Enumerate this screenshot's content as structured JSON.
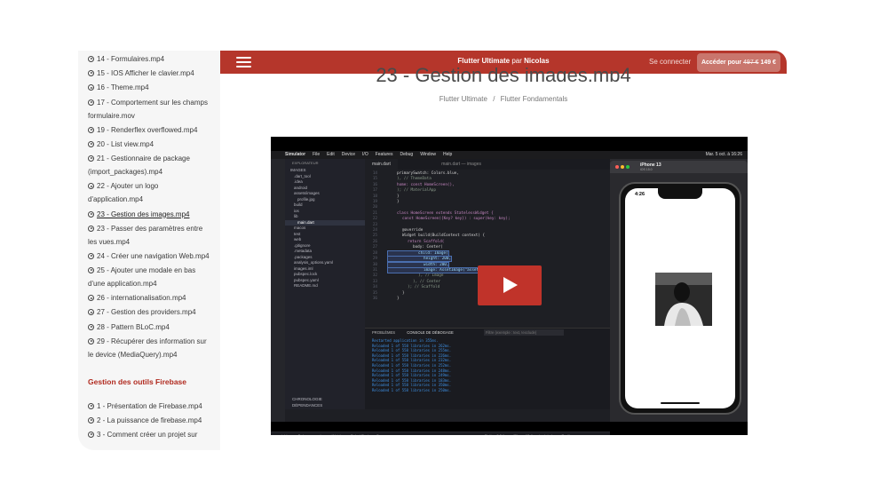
{
  "sidebar": {
    "lessons": [
      {
        "label": "14 - Formulaires.mp4"
      },
      {
        "label": "15 - IOS Afficher le clavier.mp4"
      },
      {
        "label": "16 - Theme.mp4"
      },
      {
        "label": "17 - Comportement sur les champs formulaire.mov"
      },
      {
        "label": "19 - Renderflex overflowed.mp4"
      },
      {
        "label": "20 - List view.mp4"
      },
      {
        "label": "21 - Gestionnaire de package (import_packages).mp4"
      },
      {
        "label": "22 - Ajouter un logo d'application.mp4"
      },
      {
        "label": "23 - Gestion des images.mp4"
      },
      {
        "label": "23 - Passer des paramètres entre les vues.mp4"
      },
      {
        "label": "24 - Créer une navigation Web.mp4"
      },
      {
        "label": "25 - Ajouter une modale en bas d'une application.mp4"
      },
      {
        "label": "26 - internationalisation.mp4"
      },
      {
        "label": "27 - Gestion des providers.mp4"
      },
      {
        "label": "28 - Pattern BLoC.mp4"
      },
      {
        "label": "29 - Récupérer des information sur le device (MediaQuery).mp4"
      }
    ],
    "section2_title": "Gestion des outils Firebase",
    "section2_lessons": [
      {
        "label": "1 - Présentation de Firebase.mp4"
      },
      {
        "label": "2 - La puissance de firebase.mp4"
      },
      {
        "label": "3 - Comment créer un projet sur"
      }
    ]
  },
  "header": {
    "course_name": "Flutter Ultimate",
    "by": "par",
    "author": "Nicolas",
    "login": "Se connecter",
    "access_label": "Accéder pour",
    "old_price": "497 €",
    "new_price": "149 €"
  },
  "page": {
    "title": "23 - Gestion des images.mp4",
    "breadcrumb": [
      "Flutter Ultimate",
      "Flutter Fondamentals"
    ],
    "breadcrumb_sep": "/"
  },
  "video": {
    "mac_menu": [
      "Simulator",
      "File",
      "Edit",
      "Device",
      "I/O",
      "Features",
      "Debug",
      "Window",
      "Help"
    ],
    "mac_clock": "Mar. 5 oct. à 16:26",
    "window_title": "main.dart — images",
    "explorer_title": "EXPLORATEUR",
    "explorer_items": [
      "IMAGES",
      ".dart_tool",
      ".idea",
      "android",
      "assets/images",
      "profile.jpg",
      "build",
      "ios",
      "lib",
      "main.dart",
      "macos",
      "test",
      "web",
      ".gitignore",
      ".metadata",
      ".packages",
      "analysis_options.yaml",
      "images.iml",
      "pubspec.lock",
      "pubspec.yaml",
      "README.md"
    ],
    "tab": "main.dart",
    "code_lines": [
      {
        "n": "14",
        "t": "primarySwatch: Colors.blue,"
      },
      {
        "n": "15",
        "t": "), // ThemeData"
      },
      {
        "n": "16",
        "t": "home: const HomeScreen(),"
      },
      {
        "n": "17",
        "t": "); // MaterialApp"
      },
      {
        "n": "18",
        "t": "}"
      },
      {
        "n": "19",
        "t": "}"
      },
      {
        "n": "20",
        "t": ""
      },
      {
        "n": "21",
        "t": "class HomeScreen extends StatelessWidget {"
      },
      {
        "n": "22",
        "t": "const HomeScreen({Key? key}) : super(key: key);"
      },
      {
        "n": "23",
        "t": ""
      },
      {
        "n": "24",
        "t": "@override"
      },
      {
        "n": "25",
        "t": "Widget build(BuildContext context) {"
      },
      {
        "n": "26",
        "t": "return Scaffold("
      },
      {
        "n": "27",
        "t": "body: Center("
      },
      {
        "n": "28",
        "t": "child: Image("
      },
      {
        "n": "29",
        "t": "height: 200,"
      },
      {
        "n": "30",
        "t": "width: 200,"
      },
      {
        "n": "31",
        "t": "image: AssetImage(\"assets/images/profile.jpg\"),"
      },
      {
        "n": "32",
        "t": "), // Image"
      },
      {
        "n": "33",
        "t": "), // Center"
      },
      {
        "n": "34",
        "t": "); // Scaffold"
      },
      {
        "n": "35",
        "t": "}"
      },
      {
        "n": "36",
        "t": "}"
      }
    ],
    "terminal_tabs": [
      "PROBLÈMES",
      "CONSOLE DE DÉBOGAGE"
    ],
    "terminal_filter": "Filtre (exemple : text, !exclude)",
    "terminal_lines": [
      "Restarted application in 355ms.",
      "Reloaded 1 of 558 libraries in 262ms.",
      "Reloaded 1 of 558 libraries in 255ms.",
      "Reloaded 1 of 558 libraries in 226ms.",
      "Reloaded 1 of 558 libraries in 232ms.",
      "Reloaded 1 of 558 libraries in 252ms.",
      "Reloaded 1 of 558 libraries in 248ms.",
      "Reloaded 1 of 558 libraries in 249ms.",
      "Reloaded 1 of 558 libraries in 183ms.",
      "Reloaded 1 of 558 libraries in 350ms.",
      "Reloaded 1 of 558 libraries in 250ms."
    ],
    "sidebar_bottom": [
      "CHRONOLOGIE",
      "DÉPENDANCES"
    ],
    "status_items": [
      "stable",
      "Debug my code",
      "Watch",
      "Select Postgres Server",
      "Flutter: 2.5.1",
      "iPhone 13 (ios simulator)",
      "Prettier"
    ],
    "sim_title": "iPhone 13",
    "sim_sub": "iOS 15.0",
    "phone_time": "4:26"
  },
  "colors": {
    "brand_red": "#b5362b",
    "section_red": "#b02a1f",
    "play_red": "#c0332a"
  }
}
